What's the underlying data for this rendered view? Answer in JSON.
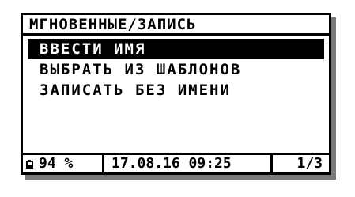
{
  "title": "МГНОВЕННЫЕ/ЗАПИСЬ",
  "menu": {
    "items": [
      {
        "label": "ВВЕСТИ ИМЯ",
        "selected": true
      },
      {
        "label": "ВЫБРАТЬ ИЗ ШАБЛОНОВ",
        "selected": false
      },
      {
        "label": "ЗАПИСАТЬ БЕЗ ИМЕНИ",
        "selected": false
      }
    ]
  },
  "status": {
    "battery_icon": "battery-icon",
    "battery": "94 %",
    "datetime": "17.08.16 09:25",
    "page": "1/3"
  }
}
